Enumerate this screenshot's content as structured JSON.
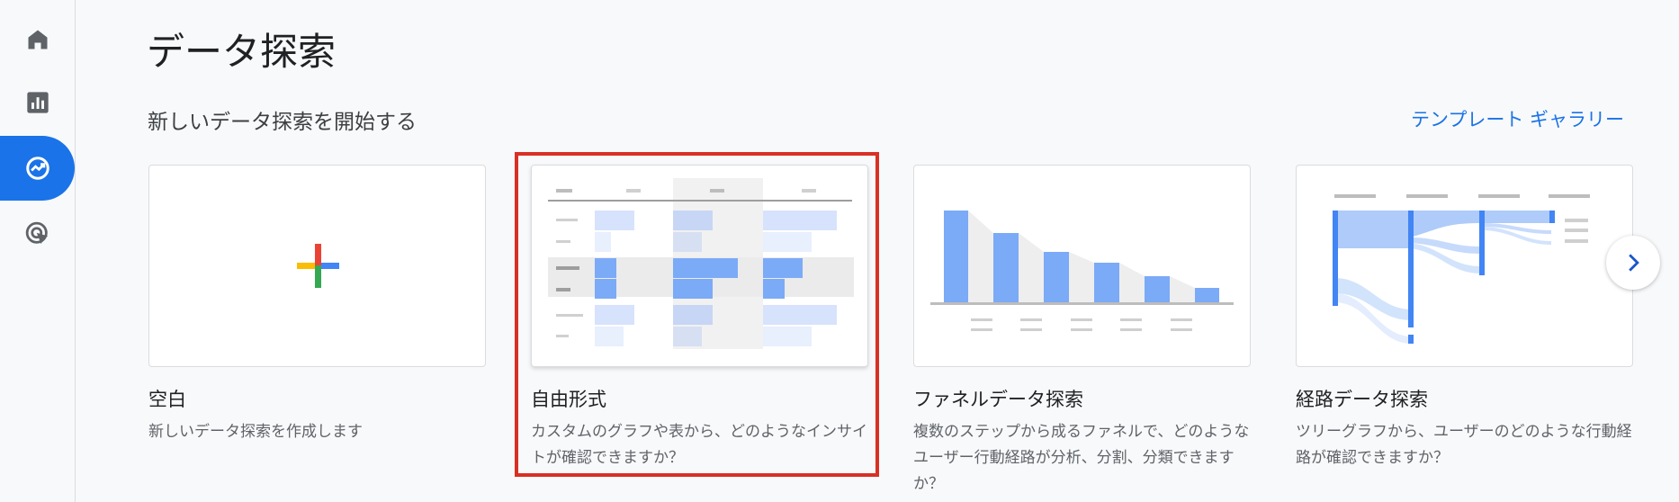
{
  "sidebar": {
    "items": [
      {
        "icon": "home-icon"
      },
      {
        "icon": "reports-icon"
      },
      {
        "icon": "explore-icon",
        "active": true
      },
      {
        "icon": "advertising-icon"
      }
    ],
    "active_color": "#1a73e8"
  },
  "page": {
    "title": "データ探索",
    "section_title": "新しいデータ探索を開始する",
    "gallery_link": "テンプレート ギャラリー"
  },
  "cards": [
    {
      "title": "空白",
      "description": "新しいデータ探索を作成します"
    },
    {
      "title": "自由形式",
      "description": "カスタムのグラフや表から、どのようなインサイトが確認できますか？"
    },
    {
      "title": "ファネルデータ探索",
      "description": "複数のステップから成るファネルで、どのようなユーザー行動経路が分析、分割、分類できますか？"
    },
    {
      "title": "経路データ探索",
      "description": "ツリーグラフから、ユーザーのどのような行動経路が確認できますか？"
    }
  ],
  "highlight_color": "#d93025",
  "next_icon": "chevron-right-icon"
}
